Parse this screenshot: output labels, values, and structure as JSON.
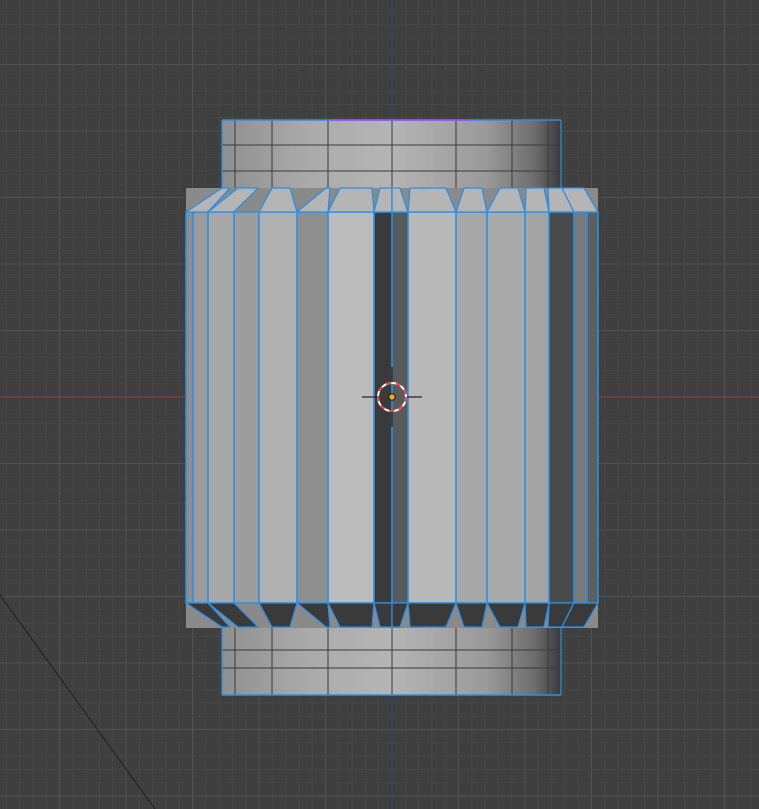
{
  "viewport": {
    "view": "front-orthographic",
    "mode": "edit-mode",
    "background_color": "#3f3f3f",
    "grid_minor_color": "#474747",
    "grid_major_color": "#525252"
  },
  "axes": {
    "x_color": "#a13a3a",
    "z_color": "#3b3b8f"
  },
  "mesh": {
    "object": "ribbed-cylinder",
    "rib_count_visible": 14,
    "selection_color": "#2b8fe6",
    "selection_highlight": "#7fd1ff",
    "active_edge_color": "#9b4dff",
    "face_light": "#bdbdbd",
    "face_mid": "#8e8e8e",
    "face_dark": "#3a3a3a"
  },
  "cursor_3d": {
    "ring_primary": "#ff3b3b",
    "ring_secondary": "#ffffff",
    "icon": "3d-cursor-icon"
  },
  "origin": {
    "color": "#ffa41b",
    "icon": "object-origin-icon"
  }
}
